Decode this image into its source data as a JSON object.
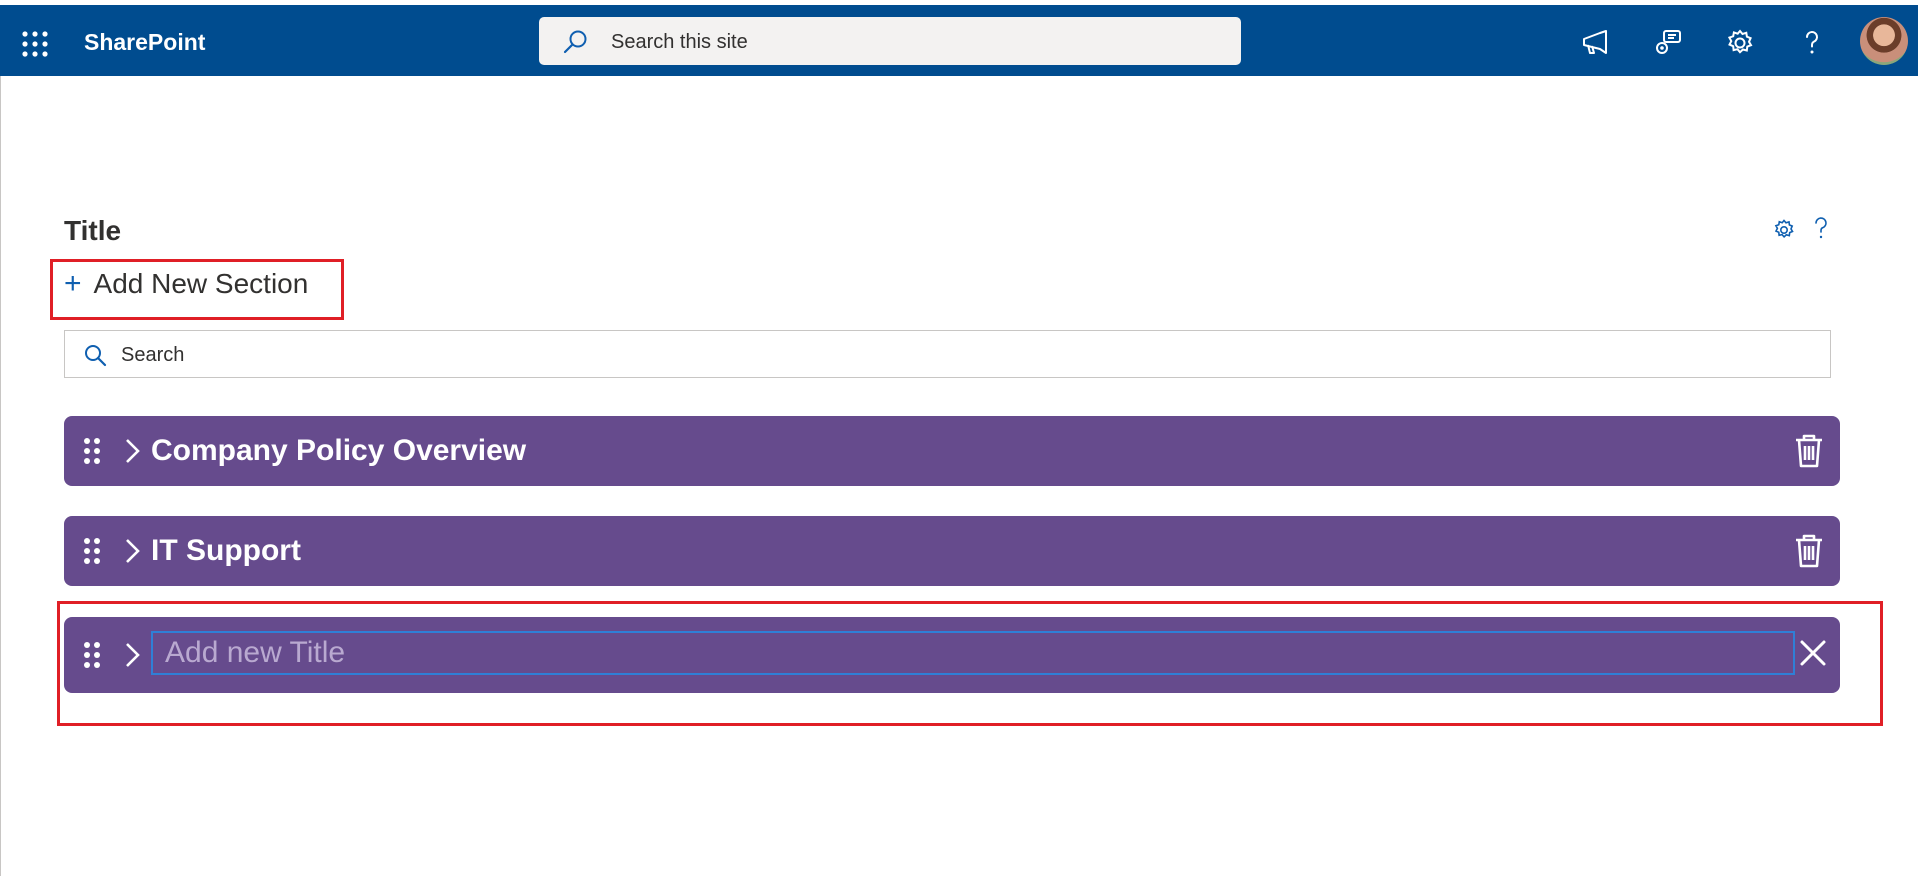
{
  "app": {
    "name": "SharePoint"
  },
  "header": {
    "search_placeholder": "Search this site",
    "icons": [
      "waffle-icon",
      "megaphone-icon",
      "chat-settings-icon",
      "gear-icon",
      "help-icon",
      "avatar"
    ]
  },
  "colors": {
    "suitebar": "#004c8f",
    "section_row": "#664b8d",
    "accent": "#0f5fb0",
    "highlight_box": "#e01f26"
  },
  "webpart": {
    "title": "Title",
    "add_section_label": "Add New Section",
    "search_placeholder": "Search",
    "sections": [
      {
        "title": "Company Policy Overview"
      },
      {
        "title": "IT Support"
      }
    ],
    "new_section": {
      "placeholder": "Add new Title",
      "value": ""
    }
  }
}
